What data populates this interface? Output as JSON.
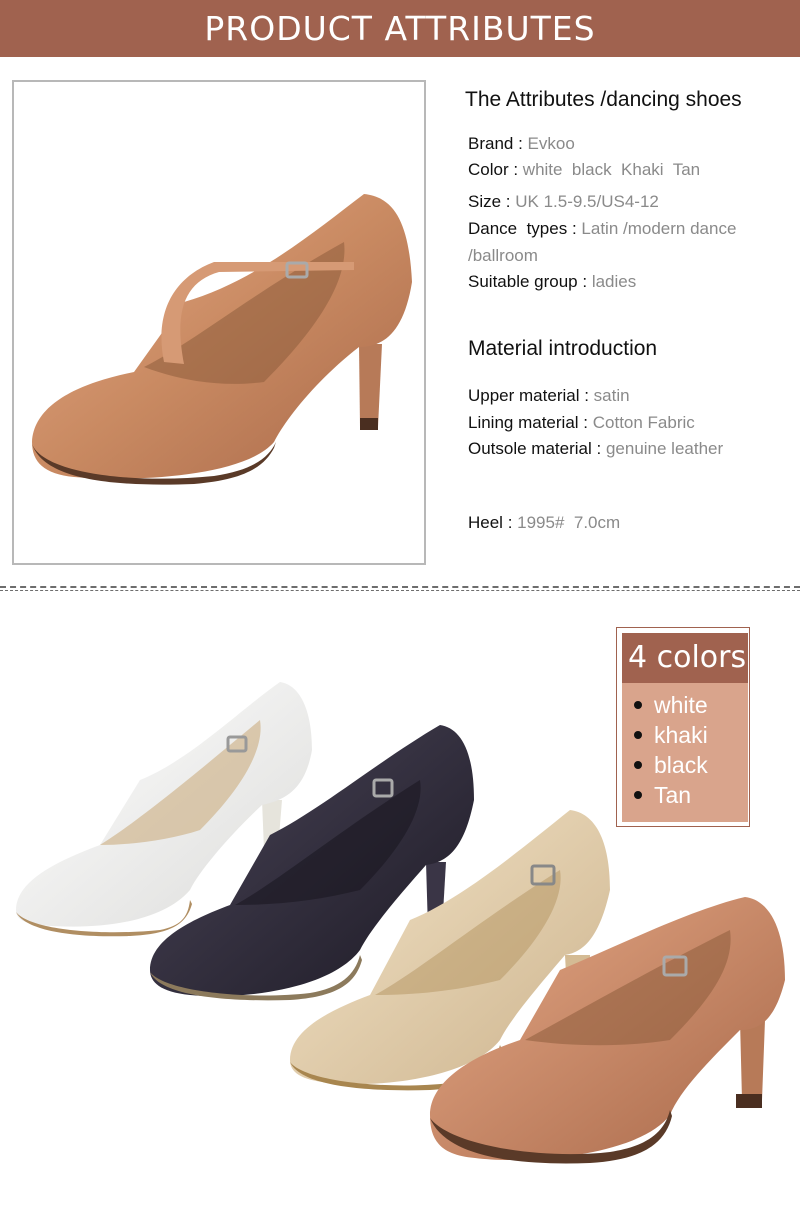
{
  "banner": {
    "title": "PRODUCT ATTRIBUTES"
  },
  "attributes": {
    "title": "The Attributes /dancing shoes",
    "brand": {
      "label": "Brand",
      "value": "Evkoo"
    },
    "color": {
      "label": "Color",
      "value": "white  black  Khaki  Tan"
    },
    "size": {
      "label": "Size",
      "value": "UK 1.5-9.5/US4-12"
    },
    "dance_types": {
      "label": "Dance  types",
      "value": "Latin /modern dance",
      "value2": "/ballroom"
    },
    "group": {
      "label": "Suitable group",
      "value": "ladies"
    }
  },
  "material": {
    "title": "Material introduction",
    "upper": {
      "label": "Upper material",
      "value": "satin"
    },
    "lining": {
      "label": "Lining material",
      "value": "Cotton Fabric"
    },
    "outsole": {
      "label": "Outsole material",
      "value": "genuine leather"
    },
    "heel": {
      "label": "Heel",
      "value": "1995#  7.0cm"
    }
  },
  "colors_panel": {
    "title": "4 colors",
    "items": [
      "white",
      "khaki",
      "black",
      "Tan"
    ]
  },
  "palette": {
    "brand_brown": "#a0624f",
    "panel_tan": "#d9a48c",
    "shoe_tan": "#c98a62",
    "shoe_white": "#f2f2f0",
    "shoe_black": "#2b2736",
    "shoe_khaki": "#e3cfae"
  }
}
